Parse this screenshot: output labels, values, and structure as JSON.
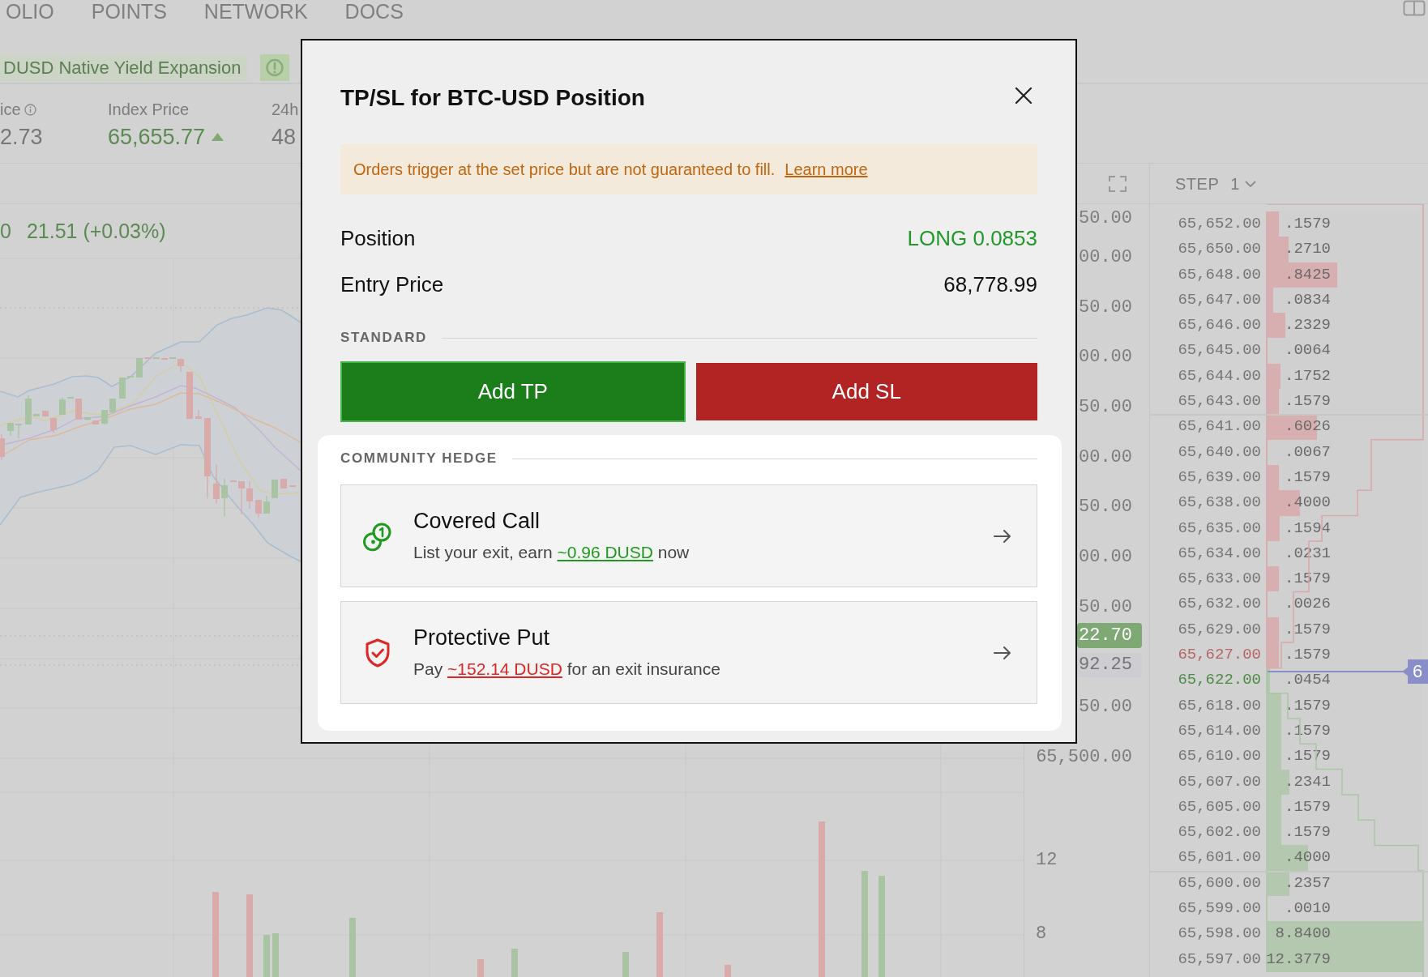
{
  "nav": {
    "items": [
      "OLIO",
      "POINTS",
      "NETWORK",
      "DOCS"
    ]
  },
  "banner": {
    "text": "DUSD Native Yield Expansion"
  },
  "stats": [
    {
      "label": "ice",
      "info": true,
      "value": "2.73",
      "rising": false
    },
    {
      "label": "Index Price",
      "info": false,
      "value": "65,655.77",
      "rising": true
    },
    {
      "label": "24h",
      "info": false,
      "value": "48",
      "rising": false
    }
  ],
  "chart": {
    "legend": [
      "0",
      "21.51 (+0.03%)"
    ]
  },
  "price_axis": {
    "upper_ticks": [
      "50.00",
      "00.00",
      "50.00",
      "00.00",
      "50.00",
      "00.00",
      "50.00",
      "00.00",
      "50.00"
    ],
    "last_price": "22.70",
    "marker_price": "92.25",
    "lower_ticks": [
      "50.00",
      "65,500.00"
    ]
  },
  "volume_axis": {
    "ticks": [
      "12",
      "8"
    ]
  },
  "order_book": {
    "step_label": "STEP",
    "step_value": "1",
    "price_tag": "6",
    "rows": [
      {
        "price": "65,652.00",
        "size": ".1579",
        "kind": "ask",
        "highlight": false,
        "level": 0.085
      },
      {
        "price": "65,650.00",
        "size": ".2710",
        "kind": "ask",
        "highlight": false,
        "level": 0.146
      },
      {
        "price": "65,648.00",
        "size": ".8425",
        "kind": "ask",
        "highlight": false,
        "level": 0.454
      },
      {
        "price": "65,647.00",
        "size": ".0834",
        "kind": "ask",
        "highlight": false,
        "level": 0.045
      },
      {
        "price": "65,646.00",
        "size": ".2329",
        "kind": "ask",
        "highlight": false,
        "level": 0.126
      },
      {
        "price": "65,645.00",
        "size": ".0064",
        "kind": "ask",
        "highlight": false,
        "level": 0.003
      },
      {
        "price": "65,644.00",
        "size": ".1752",
        "kind": "ask",
        "highlight": false,
        "level": 0.094
      },
      {
        "price": "65,643.00",
        "size": ".1579",
        "kind": "ask",
        "highlight": false,
        "level": 0.085
      },
      {
        "price": "65,641.00",
        "size": ".6026",
        "kind": "ask",
        "highlight": false,
        "level": 0.325
      },
      {
        "price": "65,640.00",
        "size": ".0067",
        "kind": "ask",
        "highlight": false,
        "level": 0.004
      },
      {
        "price": "65,639.00",
        "size": ".1579",
        "kind": "ask",
        "highlight": false,
        "level": 0.085
      },
      {
        "price": "65,638.00",
        "size": ".4000",
        "kind": "ask",
        "highlight": false,
        "level": 0.216
      },
      {
        "price": "65,635.00",
        "size": ".1594",
        "kind": "ask",
        "highlight": false,
        "level": 0.086
      },
      {
        "price": "65,634.00",
        "size": ".0231",
        "kind": "ask",
        "highlight": false,
        "level": 0.012
      },
      {
        "price": "65,633.00",
        "size": ".1579",
        "kind": "ask",
        "highlight": false,
        "level": 0.085
      },
      {
        "price": "65,632.00",
        "size": ".0026",
        "kind": "ask",
        "highlight": false,
        "level": 0.001
      },
      {
        "price": "65,629.00",
        "size": ".1579",
        "kind": "ask",
        "highlight": false,
        "level": 0.085
      },
      {
        "price": "65,627.00",
        "size": ".1579",
        "kind": "ask",
        "highlight": true,
        "level": 0.085
      },
      {
        "price": "65,622.00",
        "size": ".0454",
        "kind": "bid",
        "highlight": true,
        "level": 0.024
      },
      {
        "price": "65,618.00",
        "size": ".1579",
        "kind": "bid",
        "highlight": false,
        "level": 0.1
      },
      {
        "price": "65,614.00",
        "size": ".1579",
        "kind": "bid",
        "highlight": false,
        "level": 0.1
      },
      {
        "price": "65,610.00",
        "size": ".1579",
        "kind": "bid",
        "highlight": false,
        "level": 0.1
      },
      {
        "price": "65,607.00",
        "size": ".2341",
        "kind": "bid",
        "highlight": false,
        "level": 0.152
      },
      {
        "price": "65,605.00",
        "size": ".1579",
        "kind": "bid",
        "highlight": false,
        "level": 0.1
      },
      {
        "price": "65,602.00",
        "size": ".1579",
        "kind": "bid",
        "highlight": false,
        "level": 0.1
      },
      {
        "price": "65,601.00",
        "size": ".4000",
        "kind": "bid",
        "highlight": false,
        "level": 0.272
      },
      {
        "price": "65,600.00",
        "size": ".2357",
        "kind": "bid",
        "highlight": false,
        "level": 0.152
      },
      {
        "price": "65,599.00",
        "size": ".0010",
        "kind": "bid",
        "highlight": false,
        "level": 0.001
      },
      {
        "price": "65,598.00",
        "size": "8.8400",
        "kind": "bid",
        "highlight": false,
        "level": 1
      },
      {
        "price": "65,597.00",
        "size": "12.3779",
        "kind": "bid",
        "highlight": false,
        "level": 1
      }
    ]
  },
  "modal": {
    "title": "TP/SL for BTC-USD Position",
    "notice": {
      "text": "Orders trigger at the set price but are not guaranteed to fill.",
      "link": "Learn more"
    },
    "details": [
      {
        "label": "Position",
        "value": "LONG 0.0853",
        "positive": true
      },
      {
        "label": "Entry Price",
        "value": "68,778.99",
        "positive": false
      }
    ],
    "standard": {
      "heading": "STANDARD",
      "buttons": [
        {
          "label": "Add TP",
          "kind": "take_profit",
          "focused": true
        },
        {
          "label": "Add SL",
          "kind": "stop_loss",
          "focused": false
        }
      ]
    },
    "hedge": {
      "heading": "COMMUNITY HEDGE",
      "options": [
        {
          "kind": "covered_call",
          "title": "Covered Call",
          "text_before": "List your exit, earn",
          "amount": "~0.96 DUSD",
          "text_after": "now"
        },
        {
          "kind": "protective_put",
          "title": "Protective Put",
          "text_before": "Pay",
          "amount": "~152.14 DUSD",
          "text_after": "for an exit insurance"
        }
      ]
    }
  }
}
